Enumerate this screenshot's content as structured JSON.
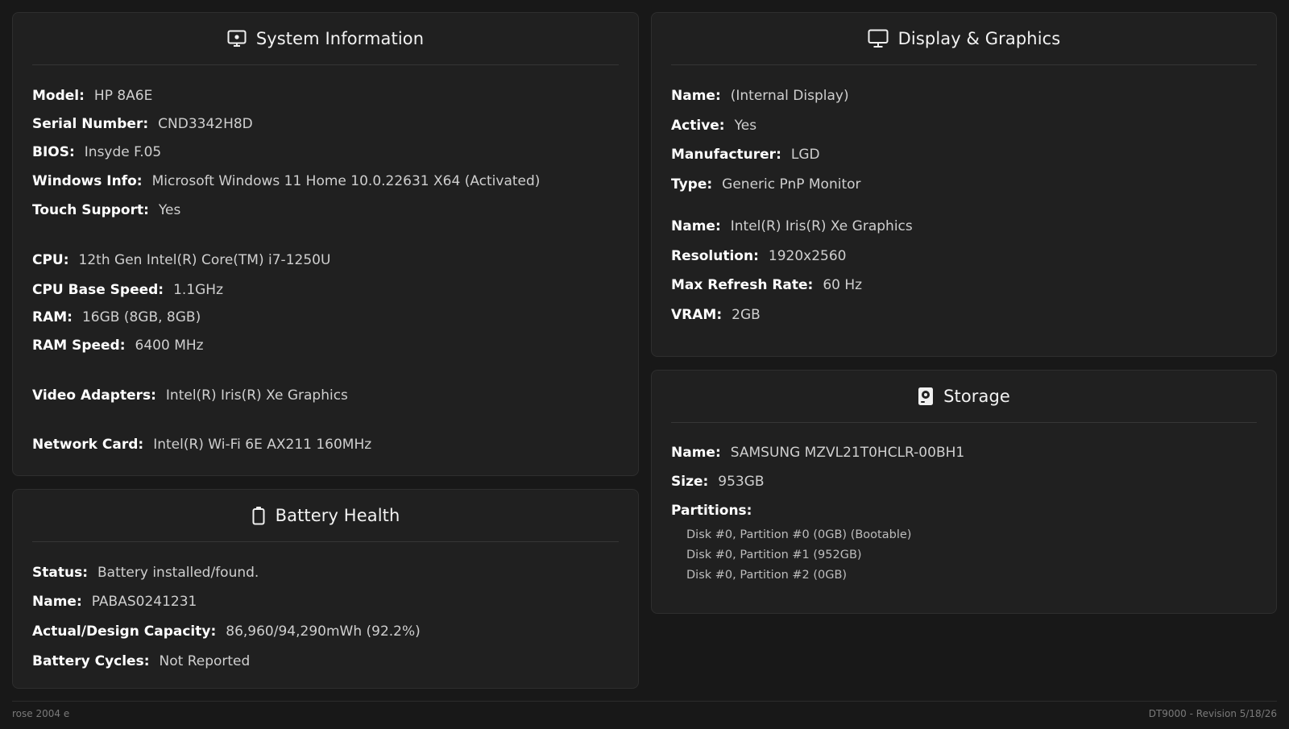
{
  "system": {
    "title": "System Information",
    "model_label": "Model:",
    "model": "HP 8A6E",
    "serial_label": "Serial Number:",
    "serial": "CND3342H8D",
    "bios_label": "BIOS:",
    "bios": "Insyde F.05",
    "windows_label": "Windows Info:",
    "windows": "Microsoft Windows 11 Home 10.0.22631 X64 (Activated)",
    "touch_label": "Touch Support:",
    "touch": "Yes",
    "cpu_label": "CPU:",
    "cpu": "12th Gen Intel(R) Core(TM) i7-1250U",
    "cpu_speed_label": "CPU Base Speed:",
    "cpu_speed": "1.1GHz",
    "ram_label": "RAM:",
    "ram": "16GB (8GB, 8GB)",
    "ram_speed_label": "RAM Speed:",
    "ram_speed": "6400 MHz",
    "video_label": "Video Adapters:",
    "video": "Intel(R) Iris(R) Xe Graphics",
    "network_label": "Network Card:",
    "network": "Intel(R) Wi-Fi 6E AX211 160MHz"
  },
  "battery": {
    "title": "Battery Health",
    "status_label": "Status:",
    "status": "Battery installed/found.",
    "name_label": "Name:",
    "name": "PABAS0241231",
    "capacity_label": "Actual/Design Capacity:",
    "capacity": "86,960/94,290mWh (92.2%)",
    "cycles_label": "Battery Cycles:",
    "cycles": "Not Reported"
  },
  "display": {
    "title": "Display & Graphics",
    "monitor": {
      "name_label": "Name:",
      "name": "(Internal Display)",
      "active_label": "Active:",
      "active": "Yes",
      "manufacturer_label": "Manufacturer:",
      "manufacturer": "LGD",
      "type_label": "Type:",
      "type": "Generic PnP Monitor"
    },
    "gpu": {
      "name_label": "Name:",
      "name": "Intel(R) Iris(R) Xe Graphics",
      "resolution_label": "Resolution:",
      "resolution": "1920x2560",
      "refresh_label": "Max Refresh Rate:",
      "refresh": "60 Hz",
      "vram_label": "VRAM:",
      "vram": "2GB"
    }
  },
  "storage": {
    "title": "Storage",
    "name_label": "Name:",
    "name": "SAMSUNG MZVL21T0HCLR-00BH1",
    "size_label": "Size:",
    "size": "953GB",
    "partitions_label": "Partitions:",
    "partitions": [
      "Disk #0, Partition #0 (0GB) (Bootable)",
      "Disk #0, Partition #1 (952GB)",
      "Disk #0, Partition #2 (0GB)"
    ]
  },
  "footer": {
    "left": "rose 2004 e",
    "right": "DT9000 - Revision 5/18/26"
  },
  "icons": {
    "system": "laptop-icon",
    "display": "monitor-icon",
    "battery": "battery-icon",
    "storage": "hard-drive-icon"
  },
  "colors": {
    "background": "#181818",
    "card": "#202020",
    "label": "#ffffff",
    "value": "#cfcfcf"
  }
}
